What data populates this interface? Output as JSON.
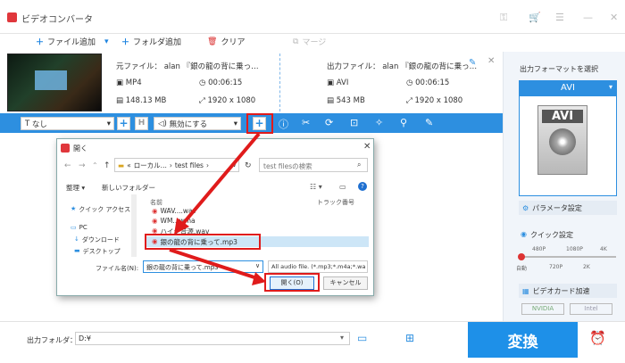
{
  "app": {
    "title": "ビデオコンバータ"
  },
  "toolbar": {
    "add_file": "ファイル追加",
    "add_folder": "フォルダ追加",
    "clear": "クリア",
    "merge": "マージ"
  },
  "source": {
    "label": "元ファイル： alan 『銀の龍の背に乗っ…",
    "format": "MP4",
    "duration": "00:06:15",
    "size": "148.13 MB",
    "resolution": "1920 x 1080"
  },
  "output": {
    "label": "出力ファイル： alan 『銀の龍の背に乗っ…",
    "format": "AVI",
    "duration": "00:06:15",
    "size": "543 MB",
    "resolution": "1920 x 1080"
  },
  "actionbar": {
    "subtitle_value": "なし",
    "audio_value": "無効にする"
  },
  "right_panel": {
    "heading": "出力フォーマットを選択",
    "format": "AVI",
    "format_icon": "AVI",
    "param_settings": "パラメータ設定",
    "quick_settings": "クイック設定",
    "quality_ticks": [
      "480P",
      "1080P",
      "4K"
    ],
    "quality_ticks_bottom": [
      "自動",
      "720P",
      "2K"
    ],
    "gpu_accel": "ビデオカード加速",
    "nvidia": "NVIDIA",
    "intel": "Intel"
  },
  "dialog": {
    "title": "開く",
    "breadcrumb": [
      "ローカル...",
      "test files"
    ],
    "search_placeholder": "test filesの検索",
    "organize": "整理",
    "new_folder": "新しいフォルダー",
    "col_name": "名前",
    "col_track": "トラック番号",
    "nav": [
      "クイック アクセス",
      "PC",
      "ダウンロード",
      "デスクトップ"
    ],
    "files": [
      "WAV....wav",
      "WM...wma",
      "ハイジ音源.wav",
      "銀の龍の背に乗って.mp3"
    ],
    "filename_label": "ファイル名(N):",
    "filename_value": "銀の龍の背に乗って.mp3",
    "filetype_value": "All audio file. (*.mp3;*.m4a;*.wa",
    "open_button": "開く(O)",
    "cancel_button": "キャンセル"
  },
  "bottom": {
    "output_folder_label": "出力フォルダ：",
    "output_folder_value": "D:¥",
    "convert": "変換"
  },
  "colors": {
    "accent": "#1e90e8",
    "highlight": "#e01b1b"
  }
}
